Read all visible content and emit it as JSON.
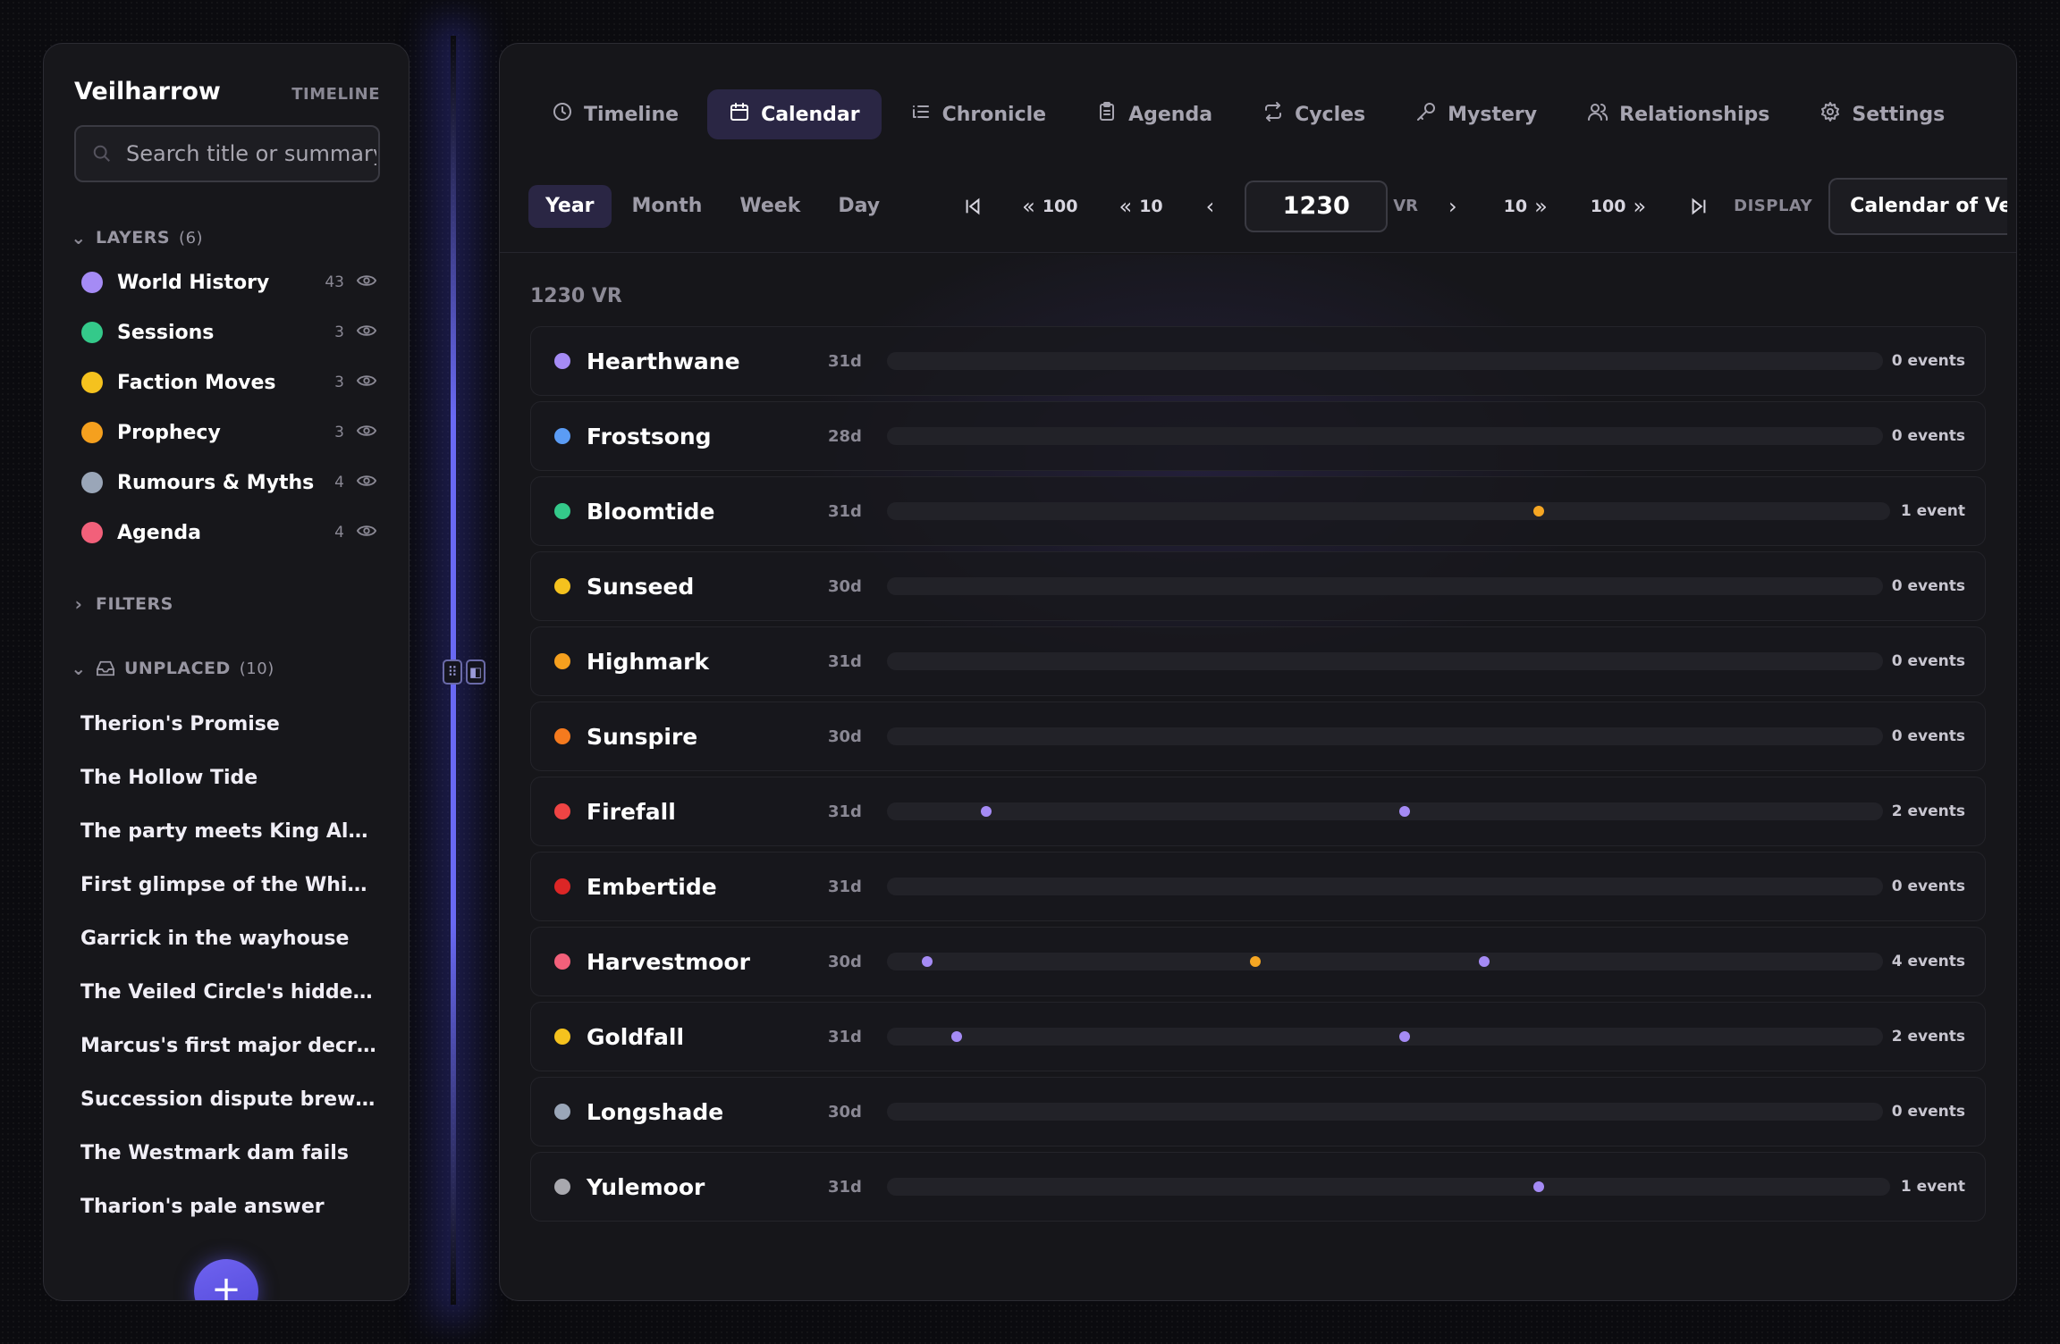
{
  "sidebar": {
    "app_title": "Veilharrow",
    "app_subtitle": "TIMELINE",
    "search_placeholder": "Search title or summary",
    "layers_label": "LAYERS",
    "layers_count": "(6)",
    "layers": [
      {
        "name": "World History",
        "count": "43",
        "color": "#a58bf5"
      },
      {
        "name": "Sessions",
        "count": "3",
        "color": "#34c98a"
      },
      {
        "name": "Faction Moves",
        "count": "3",
        "color": "#f5c21e"
      },
      {
        "name": "Prophecy",
        "count": "3",
        "color": "#f5a01e"
      },
      {
        "name": "Rumours & Myths",
        "count": "4",
        "color": "#9aa6b8"
      },
      {
        "name": "Agenda",
        "count": "4",
        "color": "#f2607a"
      }
    ],
    "filters_label": "FILTERS",
    "unplaced_label": "UNPLACED",
    "unplaced_count": "(10)",
    "unplaced": [
      "Therion's Promise",
      "The Hollow Tide",
      "The party meets King Aldren",
      "First glimpse of the Whispered…",
      "Garrick in the wayhouse",
      "The Veiled Circle's hidden arch…",
      "Marcus's first major decree",
      "Succession dispute brews in th…",
      "The Westmark dam fails",
      "Tharion's pale answer"
    ],
    "add_label": "+"
  },
  "tabs": [
    {
      "label": "Timeline",
      "icon": "clock-icon"
    },
    {
      "label": "Calendar",
      "icon": "calendar-icon"
    },
    {
      "label": "Chronicle",
      "icon": "list-icon"
    },
    {
      "label": "Agenda",
      "icon": "clipboard-icon"
    },
    {
      "label": "Cycles",
      "icon": "repeat-icon"
    },
    {
      "label": "Mystery",
      "icon": "key-icon"
    },
    {
      "label": "Relationships",
      "icon": "users-icon"
    },
    {
      "label": "Settings",
      "icon": "gear-icon"
    }
  ],
  "active_tab": "Calendar",
  "toolbar": {
    "views": [
      "Year",
      "Month",
      "Week",
      "Day"
    ],
    "active_view": "Year",
    "back100": "100",
    "back10": "10",
    "year": "1230",
    "era": "VR",
    "fwd10": "10",
    "fwd100": "100",
    "display_label": "DISPLAY",
    "display_value": "Calendar of Veilharrow"
  },
  "year_heading": "1230 VR",
  "months": [
    {
      "name": "Hearthwane",
      "days": "31d",
      "count": "0 events",
      "color": "#a58bf5",
      "events": []
    },
    {
      "name": "Frostsong",
      "days": "28d",
      "count": "0 events",
      "color": "#5b9cf5",
      "events": []
    },
    {
      "name": "Bloomtide",
      "days": "31d",
      "count": "1 event",
      "color": "#34c98a",
      "events": [
        {
          "pos": 0.65,
          "color": "#f5a623"
        }
      ]
    },
    {
      "name": "Sunseed",
      "days": "30d",
      "count": "0 events",
      "color": "#f5c21e",
      "events": []
    },
    {
      "name": "Highmark",
      "days": "31d",
      "count": "0 events",
      "color": "#f5a01e",
      "events": []
    },
    {
      "name": "Sunspire",
      "days": "30d",
      "count": "0 events",
      "color": "#f57a1e",
      "events": []
    },
    {
      "name": "Firefall",
      "days": "31d",
      "count": "2 events",
      "color": "#ef4444",
      "events": [
        {
          "pos": 0.1,
          "color": "#a58bf5"
        },
        {
          "pos": 0.52,
          "color": "#a58bf5"
        }
      ]
    },
    {
      "name": "Embertide",
      "days": "31d",
      "count": "0 events",
      "color": "#dc2626",
      "events": []
    },
    {
      "name": "Harvestmoor",
      "days": "30d",
      "count": "4 events",
      "color": "#f2607a",
      "events": [
        {
          "pos": 0.04,
          "color": "#a58bf5"
        },
        {
          "pos": 0.37,
          "color": "#f5a623"
        },
        {
          "pos": 0.6,
          "color": "#a58bf5"
        }
      ]
    },
    {
      "name": "Goldfall",
      "days": "31d",
      "count": "2 events",
      "color": "#f5c21e",
      "events": [
        {
          "pos": 0.07,
          "color": "#a58bf5"
        },
        {
          "pos": 0.52,
          "color": "#a58bf5"
        }
      ]
    },
    {
      "name": "Longshade",
      "days": "30d",
      "count": "0 events",
      "color": "#9aa6b8",
      "events": []
    },
    {
      "name": "Yulemoor",
      "days": "31d",
      "count": "1 event",
      "color": "#a8a8ae",
      "events": [
        {
          "pos": 0.65,
          "color": "#a58bf5"
        }
      ]
    }
  ]
}
